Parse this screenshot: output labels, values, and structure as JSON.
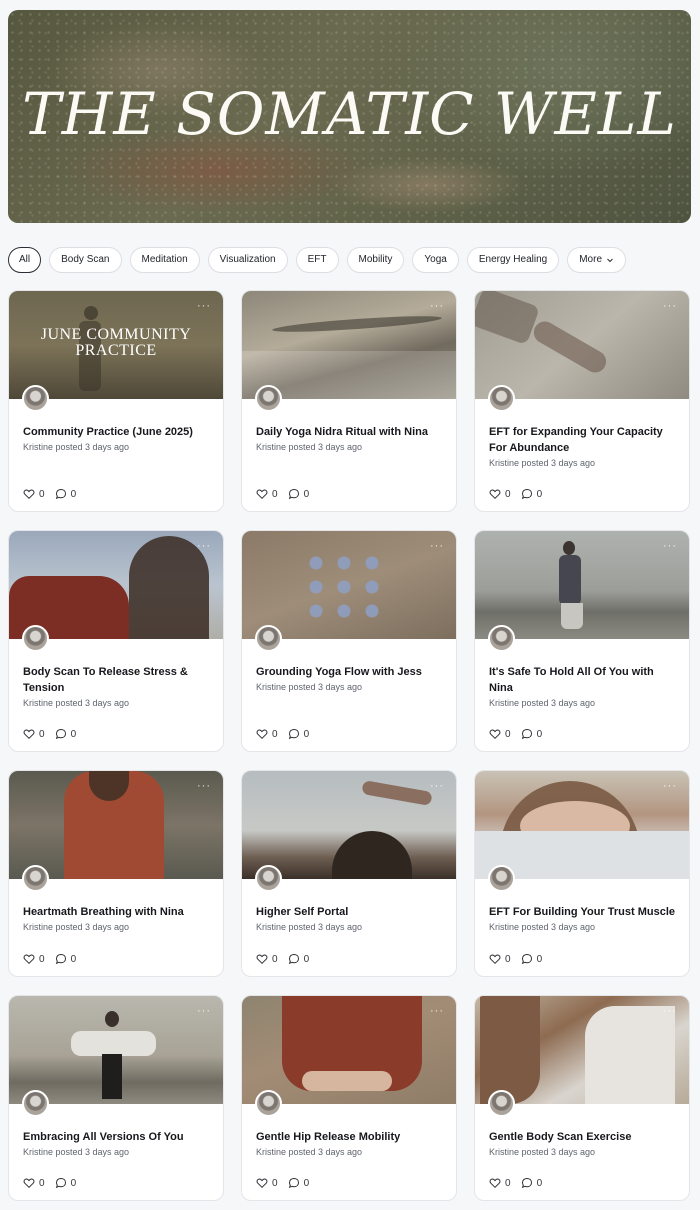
{
  "banner": {
    "title": "THE SOMATIC WELL"
  },
  "filters": [
    {
      "label": "All",
      "active": true
    },
    {
      "label": "Body Scan"
    },
    {
      "label": "Meditation"
    },
    {
      "label": "Visualization"
    },
    {
      "label": "EFT"
    },
    {
      "label": "Mobility"
    },
    {
      "label": "Yoga"
    },
    {
      "label": "Energy Healing"
    },
    {
      "label": "More",
      "dropdown": true
    }
  ],
  "cards": [
    {
      "title": "Community Practice (June 2025)",
      "thumb_text": "JUNE COMMUNITY PRACTICE",
      "meta": "Kristine posted 3 days ago",
      "likes": "0",
      "comments": "0"
    },
    {
      "title": "Daily Yoga Nidra Ritual with Nina",
      "meta": "Kristine posted 3 days ago",
      "likes": "0",
      "comments": "0"
    },
    {
      "title": "EFT for Expanding Your Capacity For Abundance",
      "meta": "Kristine posted 3 days ago",
      "likes": "0",
      "comments": "0"
    },
    {
      "title": "Body Scan To Release Stress & Tension",
      "meta": "Kristine posted 3 days ago",
      "likes": "0",
      "comments": "0"
    },
    {
      "title": "Grounding Yoga Flow with Jess",
      "meta": "Kristine posted 3 days ago",
      "likes": "0",
      "comments": "0"
    },
    {
      "title": "It's Safe To Hold All Of You with Nina",
      "meta": "Kristine posted 3 days ago",
      "likes": "0",
      "comments": "0"
    },
    {
      "title": "Heartmath Breathing with Nina",
      "meta": "Kristine posted 3 days ago",
      "likes": "0",
      "comments": "0"
    },
    {
      "title": "Higher Self Portal",
      "meta": "Kristine posted 3 days ago",
      "likes": "0",
      "comments": "0"
    },
    {
      "title": "EFT For Building Your Trust Muscle",
      "meta": "Kristine posted 3 days ago",
      "likes": "0",
      "comments": "0"
    },
    {
      "title": "Embracing All Versions Of You",
      "meta": "Kristine posted 3 days ago",
      "likes": "0",
      "comments": "0"
    },
    {
      "title": "Gentle Hip Release Mobility",
      "meta": "Kristine posted 3 days ago",
      "likes": "0",
      "comments": "0"
    },
    {
      "title": "Gentle Body Scan Exercise",
      "meta": "Kristine posted 3 days ago",
      "likes": "0",
      "comments": "0"
    }
  ],
  "icons": {
    "like": "heart-icon",
    "comment": "comment-bubble-icon",
    "menu": "more-dots-icon",
    "dropdown": "chevron-down-icon"
  }
}
